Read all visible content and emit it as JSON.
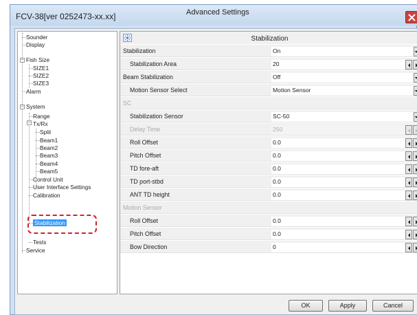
{
  "window": {
    "title": "FCV-38[ver 0252473-xx.xx]",
    "dialog_title": "Advanced Settings",
    "close_icon": "close-icon"
  },
  "tree": {
    "items": [
      {
        "label": "Sounder"
      },
      {
        "label": "Display"
      },
      {
        "label": "Fish Size"
      },
      {
        "label": "SIZE1"
      },
      {
        "label": "SIZE2"
      },
      {
        "label": "SIZE3"
      },
      {
        "label": "Alarm"
      },
      {
        "label": "System"
      },
      {
        "label": "Range"
      },
      {
        "label": "Tx/Rx"
      },
      {
        "label": "Split"
      },
      {
        "label": "Beam1"
      },
      {
        "label": "Beam2"
      },
      {
        "label": "Beam3"
      },
      {
        "label": "Beam4"
      },
      {
        "label": "Beam5"
      },
      {
        "label": "Control Unit"
      },
      {
        "label": "User Interface Settings"
      },
      {
        "label": "Calibration"
      },
      {
        "label": "Stabilization"
      },
      {
        "label": "Tests"
      },
      {
        "label": "Service"
      }
    ],
    "selected": "Stabilization"
  },
  "panel": {
    "title": "Stabilization",
    "help_icon": "help-icon",
    "rows": [
      {
        "name": "Stabilization",
        "value": "On",
        "control": "dropdown"
      },
      {
        "name": "Stabilization Area",
        "value": "20",
        "control": "spin"
      },
      {
        "name": "Beam Stabilization",
        "value": "Off",
        "control": "dropdown"
      },
      {
        "name": "Motion Sensor Select",
        "value": "Motion Sensor",
        "control": "dropdown"
      },
      {
        "name": "SC",
        "value": "",
        "control": "section"
      },
      {
        "name": "Stabilization Sensor",
        "value": "SC-50",
        "control": "dropdown"
      },
      {
        "name": "Delay Time",
        "value": "250",
        "control": "spin",
        "disabled": true
      },
      {
        "name": "Roll Offset",
        "value": "0.0",
        "control": "spin"
      },
      {
        "name": "Pitch Offset",
        "value": "0.0",
        "control": "spin"
      },
      {
        "name": "TD fore-aft",
        "value": "0.0",
        "control": "spin"
      },
      {
        "name": "TD port-stbd",
        "value": "0.0",
        "control": "spin"
      },
      {
        "name": "ANT TD height",
        "value": "0.0",
        "control": "spin"
      },
      {
        "name": "Motion Sensor",
        "value": "",
        "control": "section"
      },
      {
        "name": "Roll Offset",
        "value": "0.0",
        "control": "spin"
      },
      {
        "name": "Pitch Offset",
        "value": "0.0",
        "control": "spin"
      },
      {
        "name": "Bow Direction",
        "value": "0",
        "control": "spin"
      }
    ]
  },
  "buttons": {
    "ok": "OK",
    "apply": "Apply",
    "cancel": "Cancel"
  },
  "colors": {
    "selection": "#3399ff",
    "highlight_box": "#d0222a",
    "close_button": "#c74242"
  }
}
